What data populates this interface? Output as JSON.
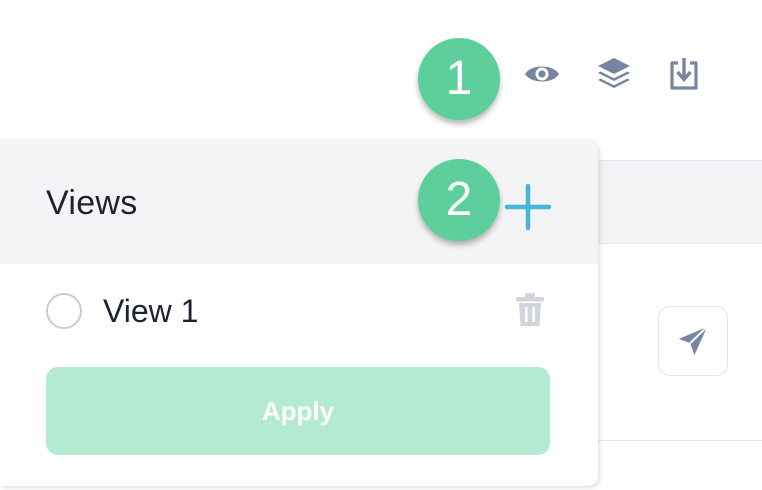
{
  "toolbar": {
    "icons": [
      "eye-icon",
      "layers-icon",
      "download-icon"
    ],
    "icon_color": "#7885a0"
  },
  "callouts": {
    "first": "1",
    "second": "2",
    "color": "#5ccf9b"
  },
  "views_panel": {
    "title": "Views",
    "add_icon": "plus-icon",
    "add_icon_color": "#44b6d8",
    "items": [
      {
        "label": "View 1",
        "selected": false,
        "delete_icon": "trash-icon"
      }
    ],
    "apply_label": "Apply",
    "apply_color": "#b3ebd2"
  },
  "background": {
    "send_icon": "paper-plane-icon"
  }
}
